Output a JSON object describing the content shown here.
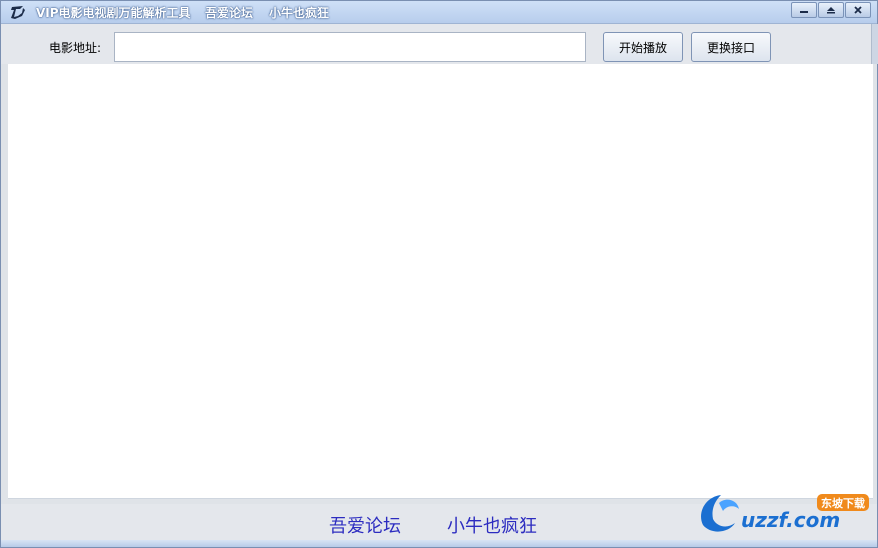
{
  "titlebar": {
    "app_name": "VIP电影电视剧万能解析工具",
    "link_1": "吾爱论坛",
    "link_2": "小牛也疯狂"
  },
  "toolbar": {
    "url_label": "电影地址:",
    "url_value": "",
    "play_button": "开始播放",
    "switch_button": "更换接口"
  },
  "footer": {
    "link_1": "吾爱论坛",
    "link_2": "小牛也疯狂"
  },
  "watermark": {
    "brand": "uzzf.com",
    "badge": "东坡下载"
  },
  "colors": {
    "footer_link": "#2c2cc0",
    "titlebar": "#b7cdec"
  }
}
